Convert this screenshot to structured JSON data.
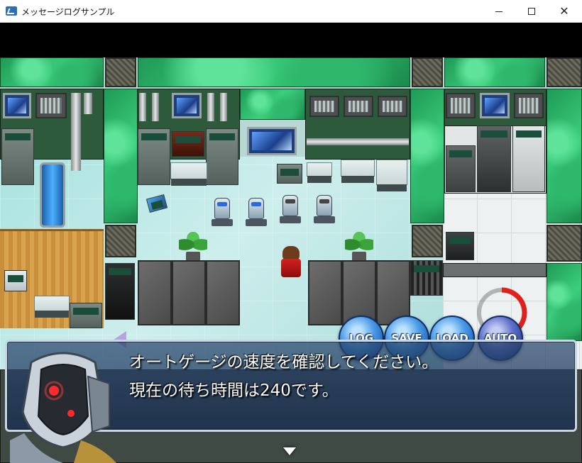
{
  "window": {
    "title": "メッセージログサンプル",
    "controls": {
      "minimize_icon": "minimize-icon",
      "maximize_icon": "maximize-icon",
      "close_icon": "close-icon",
      "close_glyph": "✕"
    }
  },
  "menu": {
    "log_label": "LOG",
    "save_label": "SAVE",
    "load_label": "LOAD",
    "auto_label": "AUTO",
    "auto_gauge_fraction": 0.4,
    "auto_gauge_color": "#e0201a"
  },
  "message": {
    "lines": [
      "オートゲージの速度を確認してください。",
      "現在の待ち時間は240です。"
    ],
    "speaker_portrait": "robot-portrait",
    "pause_icon": "pause-cursor-icon"
  },
  "colors": {
    "message_border": "#c9d6e6",
    "button_blue": "#1f5db5",
    "wall_green": "#3ccf7d"
  }
}
